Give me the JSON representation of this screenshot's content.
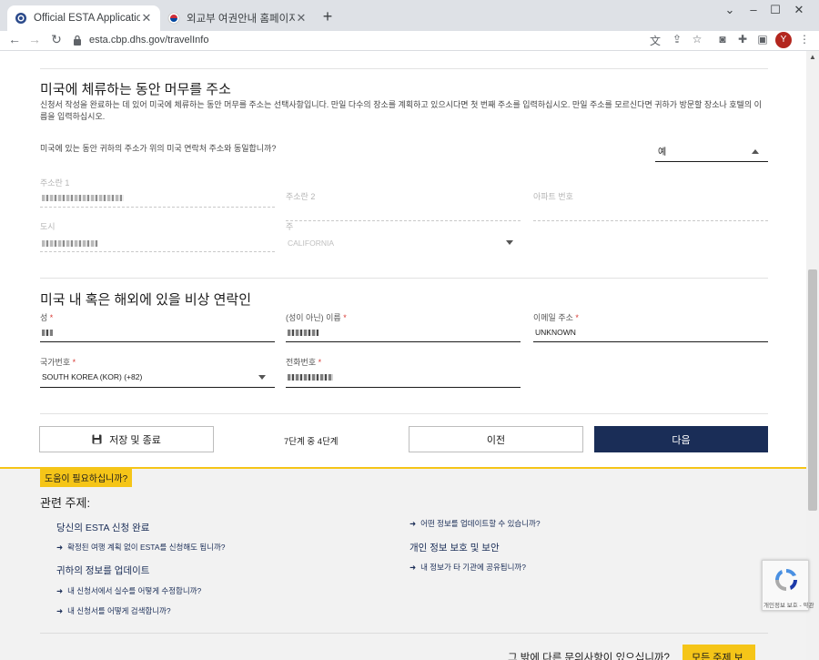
{
  "browser": {
    "tabs": [
      {
        "title": "Official ESTA Application Websi",
        "active": true
      },
      {
        "title": "외교부 여권안내 홈페이지",
        "active": false
      }
    ],
    "url": "esta.cbp.dhs.gov/travelInfo",
    "avatar_letter": "Y"
  },
  "address_section": {
    "title": "미국에 체류하는 동안 머무를 주소",
    "description": "신청서 작성을 완료하는 데 있어 미국에 체류하는 동안 머무를 주소는 선택사항입니다. 만일 다수의 장소를 계획하고 있으시다면 첫 번째 주소를 입력하십시오. 만일 주소를 모르신다면 귀하가 방문할 장소나 호텔의 이름을 입력하십시오.",
    "same_address_question": "미국에 있는 동안 귀하의 주소가 위의 미국 연락처 주소와 동일합니까?",
    "same_address_value": "예",
    "address1_label": "주소란 1",
    "address2_label": "주소란 2",
    "apartment_label": "아파트 번호",
    "city_label": "도시",
    "state_label": "주",
    "state_value": "CALIFORNIA"
  },
  "emergency_section": {
    "title": "미국 내 혹은 해외에 있을 비상 연락인",
    "surname_label": "성",
    "given_name_label": "(성이 아닌) 이름",
    "email_label": "이메일 주소",
    "email_value": "UNKNOWN",
    "country_code_label": "국가번호",
    "country_code_value": "SOUTH KOREA (KOR) (+82)",
    "phone_label": "전화번호",
    "required_mark": "*"
  },
  "actions": {
    "save_exit": "저장 및 종료",
    "step_info": "7단계 중 4단계",
    "previous": "이전",
    "next": "다음"
  },
  "help": {
    "badge": "도움이 필요하십니까?",
    "title": "관련 주제:",
    "topics": [
      {
        "title": "당신의 ESTA 신청 완료",
        "links": [
          "확정된 여행 계획 없이 ESTA를 신청해도 됩니까?"
        ]
      },
      {
        "title": "귀하의 정보를 업데이트",
        "links": [
          "내 신청서에서 실수를 어떻게 수정합니까?",
          "내 신청서를 어떻게 검색합니까?"
        ]
      },
      {
        "title": "개인 정보 보호 및 보안",
        "links": [
          "어떤 정보를 업데이트할 수 있습니까?",
          "내 정보가 타 기관에 공유됩니까?"
        ]
      }
    ],
    "more_question": "그 밖에 다른 문의사항이 있으십니까?",
    "all_topics": "모든 주제 보기"
  },
  "recaptcha_text": "개인정보 보호 - 약관",
  "colors": {
    "primary": "#1a2d57",
    "accent": "#f5c518",
    "required": "#d83933"
  }
}
